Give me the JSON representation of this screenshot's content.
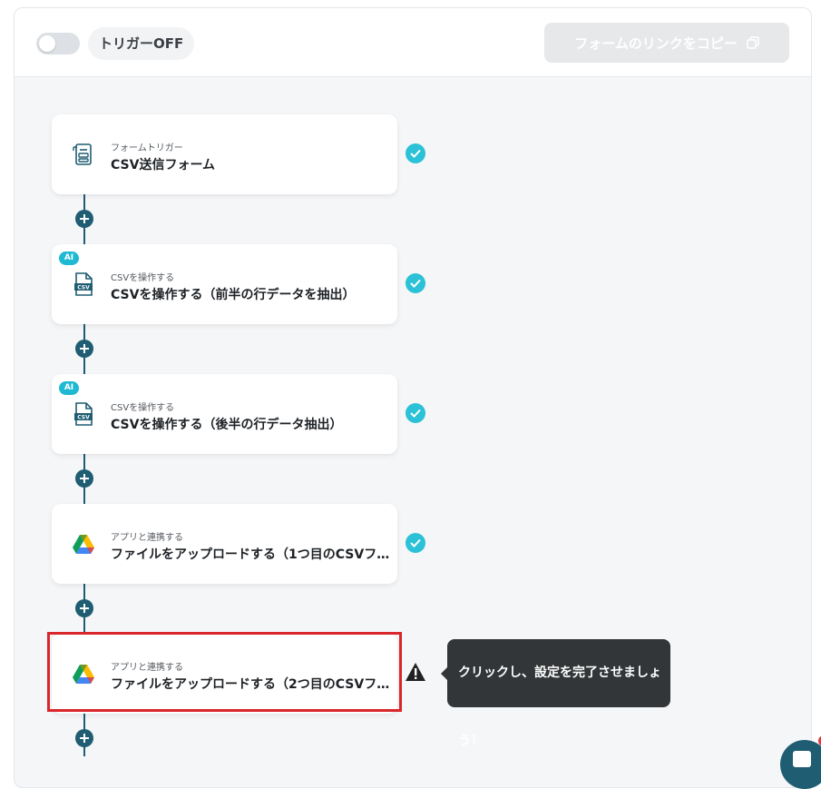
{
  "header": {
    "trigger_status": "トリガーOFF",
    "copy_link_label": "フォームのリンクをコピー"
  },
  "steps": [
    {
      "subtitle": "フォームトリガー",
      "title": "CSV送信フォーム",
      "icon": "form-icon",
      "ai": false,
      "status": "complete"
    },
    {
      "subtitle": "CSVを操作する",
      "title": "CSVを操作する（前半の行データを抽出）",
      "icon": "csv-file-icon",
      "ai": true,
      "ai_label": "AI",
      "status": "complete"
    },
    {
      "subtitle": "CSVを操作する",
      "title": "CSVを操作する（後半の行データ抽出）",
      "icon": "csv-file-icon",
      "ai": true,
      "ai_label": "AI",
      "status": "complete"
    },
    {
      "subtitle": "アプリと連携する",
      "title": "ファイルをアップロードする（1つ目のCSVフ…",
      "icon": "google-drive-icon",
      "ai": false,
      "status": "complete"
    },
    {
      "subtitle": "アプリと連携する",
      "title": "ファイルをアップロードする（2つ目のCSVフ…",
      "icon": "google-drive-icon",
      "ai": false,
      "status": "warning"
    }
  ],
  "tooltip": {
    "text": "クリックし、設定を完了させましょう！"
  },
  "colors": {
    "accent": "#1f5d72",
    "check": "#2bc1d6",
    "highlight": "#d9262b",
    "tooltip_bg": "#333638"
  }
}
